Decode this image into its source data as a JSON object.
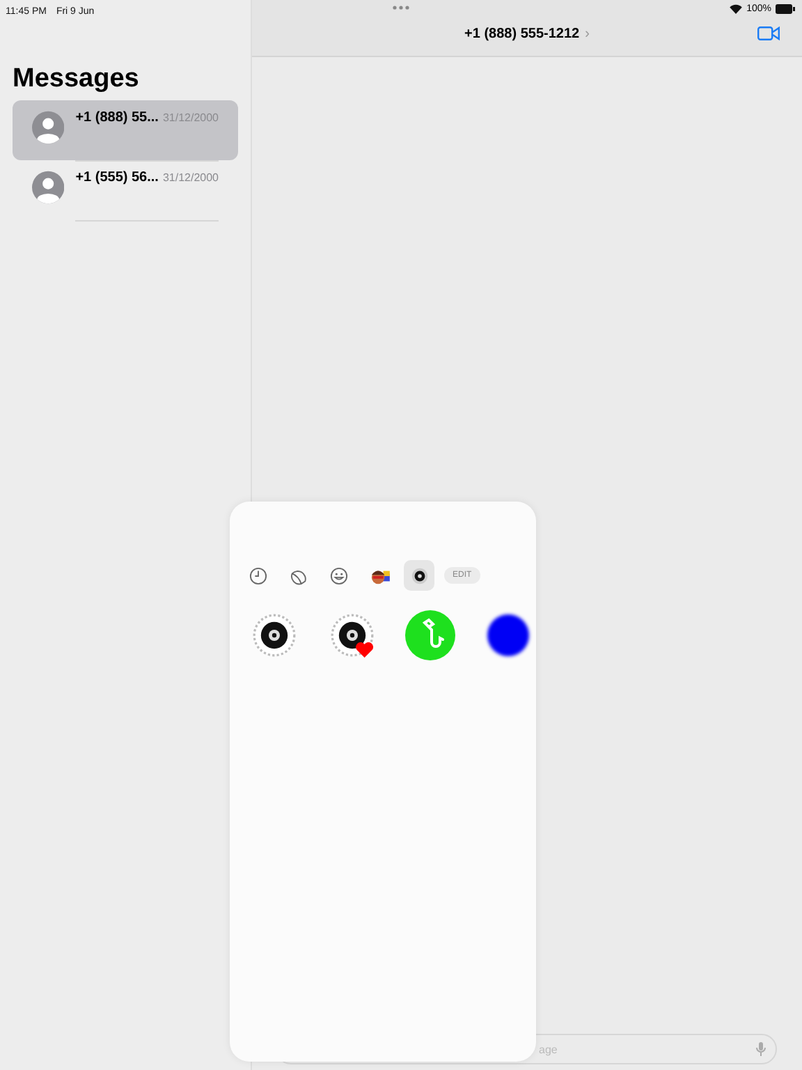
{
  "status_bar": {
    "time": "11:45 PM",
    "date": "Fri 9 Jun",
    "battery": "100%"
  },
  "sidebar": {
    "title": "Messages",
    "conversations": [
      {
        "name": "+1 (888) 55...",
        "date": "31/12/2000",
        "selected": true
      },
      {
        "name": "+1 (555) 56...",
        "date": "31/12/2000",
        "selected": false
      }
    ]
  },
  "conversation": {
    "title": "+1 (888) 555-1212",
    "chevron": "›"
  },
  "message_field": {
    "placeholder": "age"
  },
  "sticker_drawer": {
    "tabs": [
      {
        "kind": "recent",
        "selected": false
      },
      {
        "kind": "stickers",
        "selected": false
      },
      {
        "kind": "emoji",
        "selected": false
      },
      {
        "kind": "memoji",
        "selected": false
      },
      {
        "kind": "disc",
        "selected": true
      }
    ],
    "edit_label": "EDIT",
    "stickers": [
      {
        "kind": "disc"
      },
      {
        "kind": "disc-heart"
      },
      {
        "kind": "saxophone"
      },
      {
        "kind": "blue-circle"
      }
    ]
  }
}
